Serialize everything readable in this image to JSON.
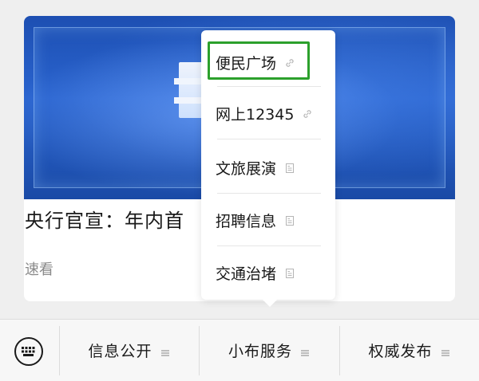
{
  "article": {
    "title": "央行官宣：年内首",
    "tag": "速看"
  },
  "menu": {
    "items": [
      {
        "label": "便民广场",
        "icon": "link-icon"
      },
      {
        "label": "网上12345",
        "icon": "link-icon"
      },
      {
        "label": "文旅展演",
        "icon": "page-icon"
      },
      {
        "label": "招聘信息",
        "icon": "page-icon"
      },
      {
        "label": "交通治堵",
        "icon": "page-icon"
      }
    ],
    "selected_index": 0,
    "highlight_color": "#2ca02c"
  },
  "bottom_bar": {
    "keyboard_icon": "keyboard-icon",
    "tabs": [
      {
        "label": "信息公开",
        "icon": "menu-lines-icon"
      },
      {
        "label": "小布服务",
        "icon": "menu-lines-icon"
      },
      {
        "label": "权威发布",
        "icon": "menu-lines-icon"
      }
    ]
  },
  "colors": {
    "background": "#efefef",
    "banner_blue": "#2a64cf",
    "muted_text": "#8a8a8a"
  }
}
